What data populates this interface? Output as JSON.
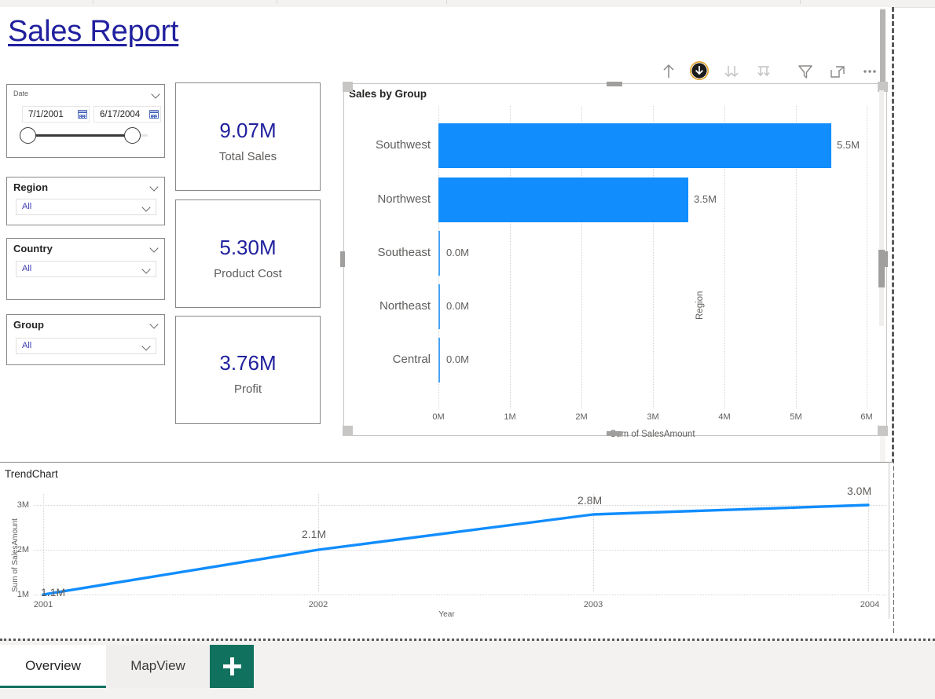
{
  "report": {
    "title": "Sales Report",
    "title_color": "#20209e"
  },
  "theme": {
    "accent_blue": "#118DFE",
    "navy": "#20209e",
    "teal": "#11715f",
    "muted_text": "#605e5c"
  },
  "slicers": {
    "date": {
      "header": "Date",
      "start": "7/1/2001",
      "end": "6/17/2004",
      "start_icon": "calendar-icon",
      "end_icon": "calendar-icon",
      "expand_icon": "chevron-down-icon"
    },
    "region": {
      "header": "Region",
      "value": "All",
      "expand_icon": "chevron-down-icon",
      "dropdown_icon": "chevron-down-icon"
    },
    "country": {
      "header": "Country",
      "value": "All",
      "expand_icon": "chevron-down-icon",
      "dropdown_icon": "chevron-down-icon"
    },
    "group": {
      "header": "Group",
      "value": "All",
      "expand_icon": "chevron-down-icon",
      "dropdown_icon": "chevron-down-icon"
    }
  },
  "kpis": [
    {
      "value": "9.07M",
      "label": "Total Sales"
    },
    {
      "value": "5.30M",
      "label": "Product Cost"
    },
    {
      "value": "3.76M",
      "label": "Profit"
    }
  ],
  "visual_toolbar": {
    "buttons": [
      {
        "name": "drill-up-icon",
        "tooltip": "Drill up",
        "state": "normal"
      },
      {
        "name": "drill-down-icon",
        "tooltip": "Drill down",
        "state": "active"
      },
      {
        "name": "expand-all-down-icon",
        "tooltip": "Expand all down",
        "state": "dim"
      },
      {
        "name": "drill-down-level-icon",
        "tooltip": "Go to next level",
        "state": "dim"
      },
      {
        "name": "filter-icon",
        "tooltip": "Filters",
        "state": "normal"
      },
      {
        "name": "focus-mode-icon",
        "tooltip": "Focus mode",
        "state": "normal"
      },
      {
        "name": "more-options-icon",
        "tooltip": "More options",
        "state": "normal"
      }
    ]
  },
  "bar_chart_title": "Sales by Group",
  "trend_chart_title": "TrendChart",
  "tabs": {
    "items": [
      {
        "label": "Overview",
        "active": true
      },
      {
        "label": "MapView",
        "active": false
      }
    ],
    "add_button": {
      "name": "add-page-button",
      "label": "+"
    }
  },
  "chart_data": [
    {
      "type": "bar",
      "orientation": "horizontal",
      "title": "Sales by Group",
      "xlabel": "Sum of SalesAmount",
      "ylabel": "Region",
      "categories": [
        "Southwest",
        "Northwest",
        "Southeast",
        "Northeast",
        "Central"
      ],
      "values": [
        5.5,
        3.5,
        0.0,
        0.0,
        0.0
      ],
      "data_labels": [
        "5.5M",
        "3.5M",
        "0.0M",
        "0.0M",
        "0.0M"
      ],
      "xlim": [
        0,
        6
      ],
      "xticks": [
        0,
        1,
        2,
        3,
        4,
        5,
        6
      ],
      "xtick_labels": [
        "0M",
        "1M",
        "2M",
        "3M",
        "4M",
        "5M",
        "6M"
      ],
      "units": "millions",
      "series_color": "#118DFE",
      "grid": true,
      "legend": "none"
    },
    {
      "type": "line",
      "title": "TrendChart",
      "xlabel": "Year",
      "ylabel": "Sum of SalesAmount",
      "x": [
        "2001",
        "2002",
        "2003",
        "2004"
      ],
      "values": [
        1.1,
        2.1,
        2.8,
        3.0
      ],
      "data_labels": [
        "1.1M",
        "2.1M",
        "2.8M",
        "3.0M"
      ],
      "ylim": [
        1.0,
        3.3
      ],
      "yticks": [
        1,
        2,
        3
      ],
      "ytick_labels": [
        "1M",
        "2M",
        "3M"
      ],
      "units": "millions",
      "series_color": "#118DFE",
      "grid": true,
      "legend": "none"
    }
  ]
}
